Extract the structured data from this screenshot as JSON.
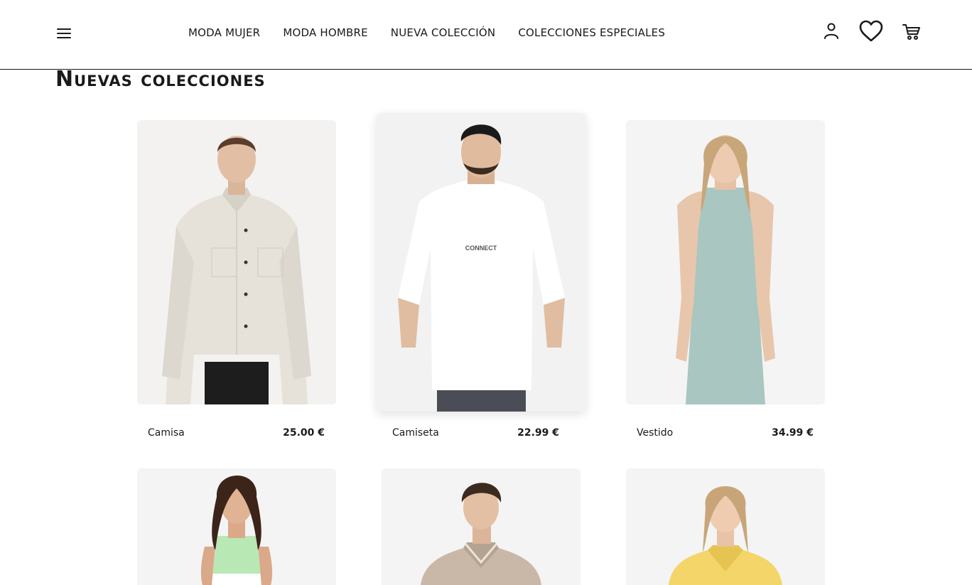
{
  "nav": {
    "items": [
      {
        "label": "MODA MUJER"
      },
      {
        "label": "MODA HOMBRE"
      },
      {
        "label": "NUEVA COLECCIÓN"
      },
      {
        "label": "COLECCIONES ESPECIALES"
      }
    ]
  },
  "header_icons": [
    "menu-icon",
    "user-icon",
    "heart-icon",
    "cart-icon"
  ],
  "section": {
    "title": "Nuevas colecciones"
  },
  "products": [
    {
      "name": "Camisa",
      "price": "25.00 €",
      "image_desc": "shirt-photo"
    },
    {
      "name": "Camiseta",
      "price": "22.99 €",
      "image_desc": "tshirt-photo"
    },
    {
      "name": "Vestido",
      "price": "34.99 €",
      "image_desc": "dress-photo"
    },
    {
      "name": "",
      "price": "",
      "image_desc": "green-top-photo"
    },
    {
      "name": "",
      "price": "",
      "image_desc": "beige-polo-photo"
    },
    {
      "name": "",
      "price": "",
      "image_desc": "yellow-polo-photo"
    }
  ],
  "colors": {
    "text": "#1a1a1a",
    "background": "#ffffff",
    "divider": "#1a1a1a"
  }
}
